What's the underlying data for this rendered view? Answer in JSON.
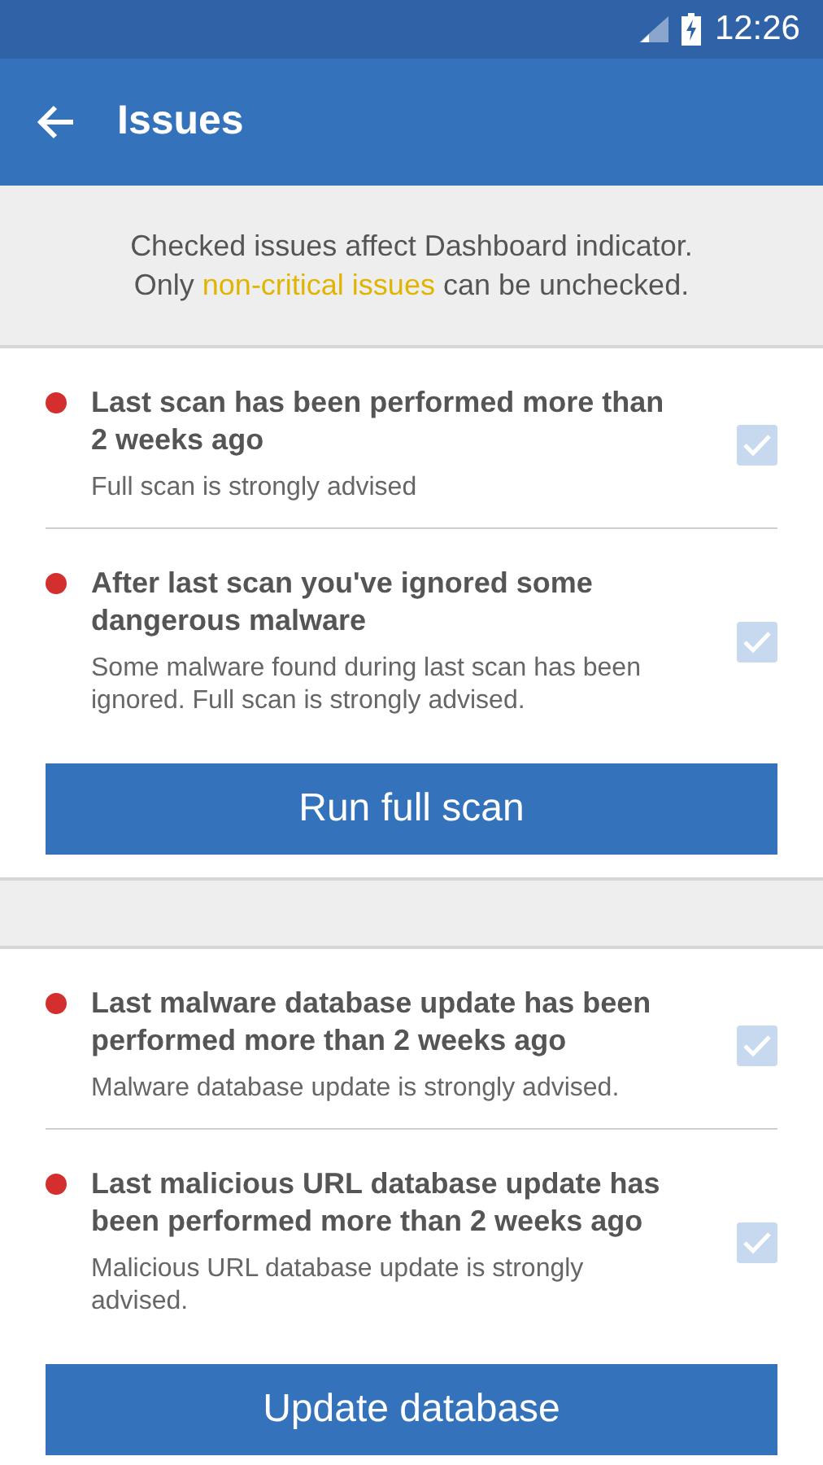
{
  "status_bar": {
    "time": "12:26"
  },
  "app_bar": {
    "title": "Issues"
  },
  "info": {
    "text": "Checked issues affect Dashboard indicator.\nOnly *non-critical issues* can be unchecked."
  },
  "sections": [
    {
      "issues": [
        {
          "title": "Last scan has been performed more than 2 weeks ago",
          "description": "Full scan is strongly advised",
          "color": "#d32f2f",
          "checked": true,
          "disabled": true
        },
        {
          "title": "After last scan you've ignored some dangerous malware",
          "description": "Some malware found during last scan has been ignored. Full scan is strongly advised.",
          "color": "#d32f2f",
          "checked": true,
          "disabled": true
        }
      ],
      "button": "Run full scan"
    },
    {
      "issues": [
        {
          "title": "Last malware database update has been performed more than 2 weeks ago",
          "description": "Malware database update is strongly advised.",
          "color": "#d32f2f",
          "checked": true,
          "disabled": true
        },
        {
          "title": "Last malicious URL database update has been performed more than 2 weeks ago",
          "description": "Malicious URL database update is strongly advised.",
          "color": "#d32f2f",
          "checked": true,
          "disabled": true
        }
      ],
      "button": "Update database"
    }
  ]
}
